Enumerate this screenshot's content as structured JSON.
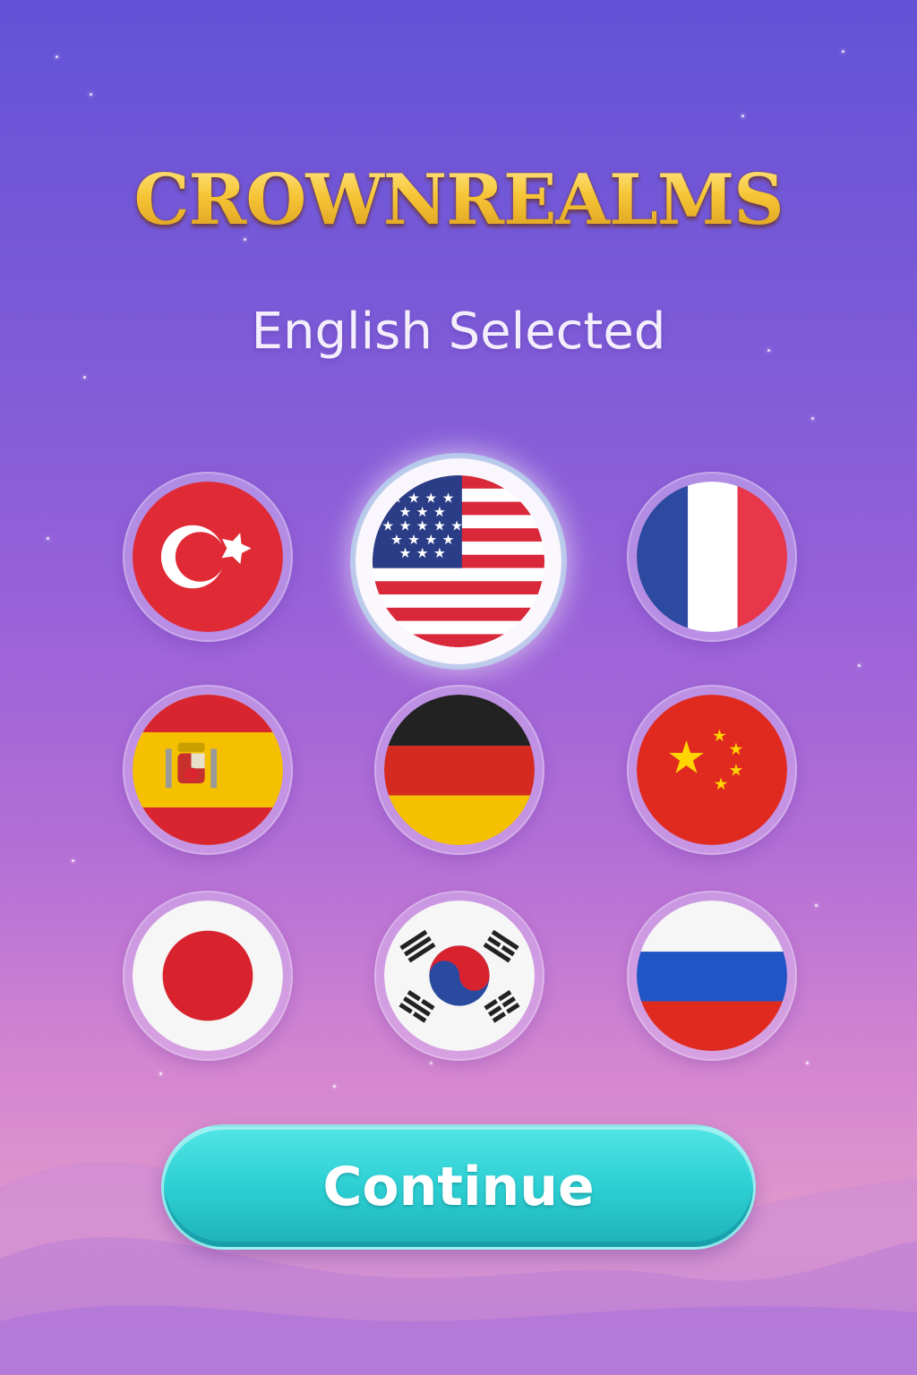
{
  "app": {
    "title": "CROWNREALMS",
    "status_text": "English Selected"
  },
  "languages": [
    {
      "name": "turkish",
      "icon": "turkey-flag-icon",
      "selected": false
    },
    {
      "name": "english",
      "icon": "usa-flag-icon",
      "selected": true
    },
    {
      "name": "french",
      "icon": "france-flag-icon",
      "selected": false
    },
    {
      "name": "spanish",
      "icon": "spain-flag-icon",
      "selected": false
    },
    {
      "name": "german",
      "icon": "germany-flag-icon",
      "selected": false
    },
    {
      "name": "chinese",
      "icon": "china-flag-icon",
      "selected": false
    },
    {
      "name": "japanese",
      "icon": "japan-flag-icon",
      "selected": false
    },
    {
      "name": "korean",
      "icon": "south-korea-flag-icon",
      "selected": false
    },
    {
      "name": "russian",
      "icon": "russia-flag-icon",
      "selected": false
    }
  ],
  "actions": {
    "continue_label": "Continue"
  },
  "colors": {
    "title_gold": "#f6c536",
    "button_teal": "#2ccfd3",
    "background_top": "#6352d6",
    "background_bottom": "#e19acb"
  }
}
